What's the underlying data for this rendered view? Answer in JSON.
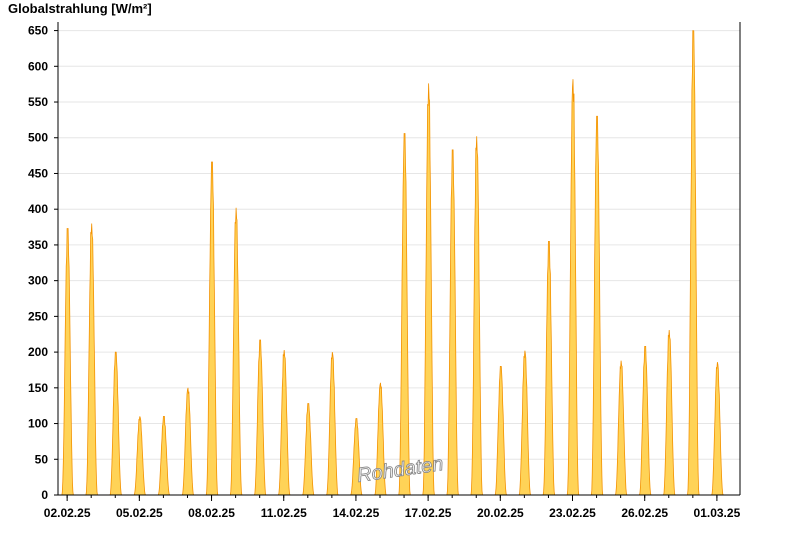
{
  "chart_data": {
    "type": "area",
    "title": "",
    "ylabel": "Globalstrahlung [W/m²]",
    "xlabel": "",
    "watermark": "Rohdaten",
    "ylim": [
      0,
      662
    ],
    "yticks": [
      0,
      50,
      100,
      150,
      200,
      250,
      300,
      350,
      400,
      450,
      500,
      550,
      600,
      650
    ],
    "x_start": "01.02.25",
    "xlim_days": [
      0.62,
      28.96
    ],
    "xtick_labels": [
      "02.02.25",
      "05.02.25",
      "08.02.25",
      "11.02.25",
      "14.02.25",
      "17.02.25",
      "20.02.25",
      "23.02.25",
      "26.02.25",
      "01.03.25"
    ],
    "xtick_days": [
      1,
      4,
      7,
      10,
      13,
      16,
      19,
      22,
      25,
      28
    ],
    "grid": true,
    "fill_color": "#FFD357",
    "line_color": "#F39200",
    "series": [
      {
        "values": [
          {
            "date": "02.02.25",
            "peak": 373
          },
          {
            "date": "03.02.25",
            "peak": 380
          },
          {
            "date": "04.02.25",
            "peak": 200
          },
          {
            "date": "05.02.25",
            "peak": 110
          },
          {
            "date": "06.02.25",
            "peak": 110
          },
          {
            "date": "07.02.25",
            "peak": 150
          },
          {
            "date": "08.02.25",
            "peak": 466
          },
          {
            "date": "09.02.25",
            "peak": 402
          },
          {
            "date": "10.02.25",
            "peak": 217
          },
          {
            "date": "11.02.25",
            "peak": 203
          },
          {
            "date": "12.02.25",
            "peak": 128
          },
          {
            "date": "13.02.25",
            "peak": 200
          },
          {
            "date": "14.02.25",
            "peak": 107
          },
          {
            "date": "15.02.25",
            "peak": 157
          },
          {
            "date": "16.02.25",
            "peak": 506
          },
          {
            "date": "17.02.25",
            "peak": 576
          },
          {
            "date": "18.02.25",
            "peak": 483
          },
          {
            "date": "19.02.25",
            "peak": 502
          },
          {
            "date": "20.02.25",
            "peak": 180
          },
          {
            "date": "21.02.25",
            "peak": 202
          },
          {
            "date": "22.02.25",
            "peak": 355
          },
          {
            "date": "23.02.25",
            "peak": 582
          },
          {
            "date": "24.02.25",
            "peak": 530
          },
          {
            "date": "25.02.25",
            "peak": 188
          },
          {
            "date": "26.02.25",
            "peak": 208
          },
          {
            "date": "27.02.25",
            "peak": 231
          },
          {
            "date": "28.02.25",
            "peak": 650
          },
          {
            "date": "01.03.25",
            "peak": 186
          }
        ]
      }
    ]
  }
}
